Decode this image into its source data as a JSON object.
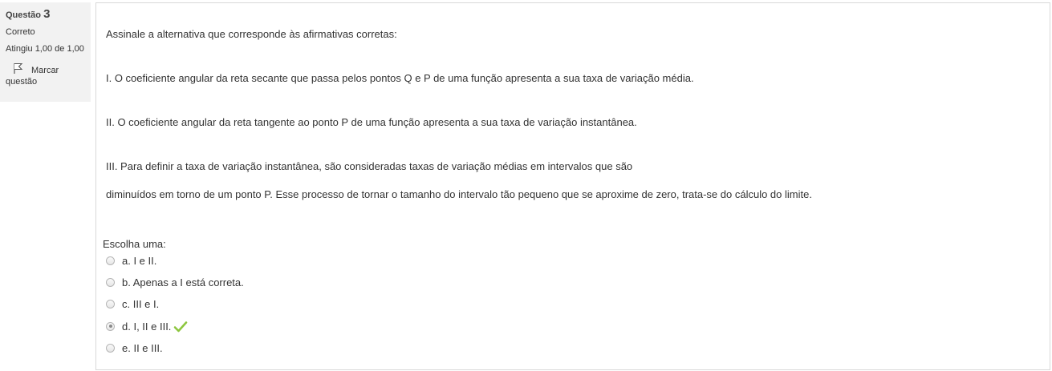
{
  "question_info": {
    "label": "Questão",
    "number": "3",
    "state": "Correto",
    "grade": "Atingiu 1,00 de 1,00",
    "flag_label": "Marcar",
    "flag_label_2": "questão"
  },
  "question": {
    "lines": [
      "Assinale a alternativa que corresponde às afirmativas corretas:",
      "I. O coeficiente angular da reta secante que passa pelos pontos Q e P de uma função apresenta a sua taxa de variação média.",
      "II. O coeficiente angular da reta tangente ao ponto P de uma função apresenta a sua taxa de variação instantânea.",
      "III. Para definir a taxa de variação instantânea, são consideradas taxas de variação médias em intervalos que são",
      "diminuídos em torno de um ponto P. Esse processo de tornar o tamanho do intervalo tão pequeno que se aproxime de zero, trata-se do cálculo do limite."
    ],
    "prompt": "Escolha uma:",
    "options": [
      {
        "label": "a. I e II.",
        "selected": false
      },
      {
        "label": "b. Apenas a I está correta.",
        "selected": false
      },
      {
        "label": "c. III e I.",
        "selected": false
      },
      {
        "label": "d. I, II e III.",
        "selected": true,
        "correct": true
      },
      {
        "label": "e. II e III.",
        "selected": false
      }
    ]
  },
  "colors": {
    "info_bg": "#f2f2f2",
    "border": "#d8d8d8",
    "correct_check": "#8dc63f"
  },
  "icons": {
    "flag": "flag-icon",
    "correct": "checkmark-icon"
  }
}
